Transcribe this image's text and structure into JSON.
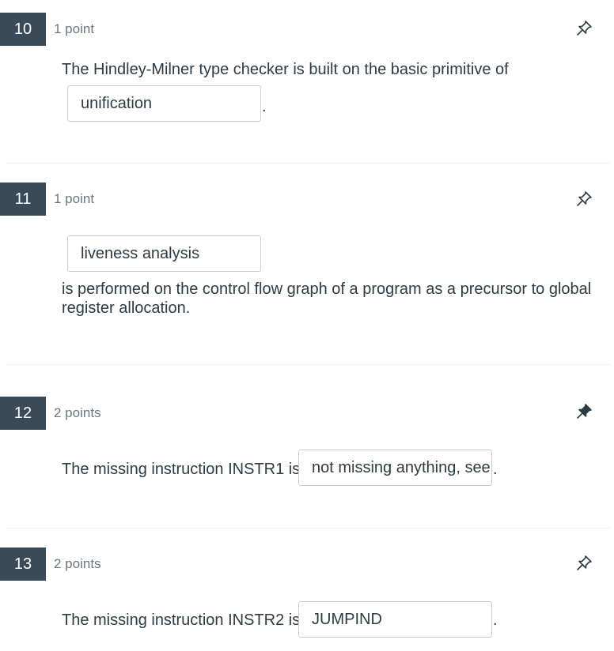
{
  "questions": [
    {
      "number": "10",
      "points": "1 point",
      "pinned": false,
      "text_before": "The Hindley-Milner type checker is built on the basic primitive of",
      "answer": "unification",
      "text_after": "."
    },
    {
      "number": "11",
      "points": "1 point",
      "pinned": false,
      "answer": "liveness analysis",
      "text_after_line1": "is performed on the control flow graph of a program as a precursor to global",
      "text_after_line2": "register allocation."
    },
    {
      "number": "12",
      "points": "2 points",
      "pinned": true,
      "text_before": "The missing instruction INSTR1 is",
      "answer": "not missing anything, see",
      "text_after": "."
    },
    {
      "number": "13",
      "points": "2 points",
      "pinned": false,
      "text_before": "The missing instruction INSTR2 is",
      "answer": "JUMPIND",
      "text_after": "."
    }
  ],
  "icons": {
    "pin_outline": "pin-outline-icon",
    "pin_filled": "pin-filled-icon"
  },
  "colors": {
    "number_badge_bg": "#394b58",
    "text": "#2d3b45",
    "muted_text": "#6b7780",
    "input_border": "#c7cdd1"
  }
}
